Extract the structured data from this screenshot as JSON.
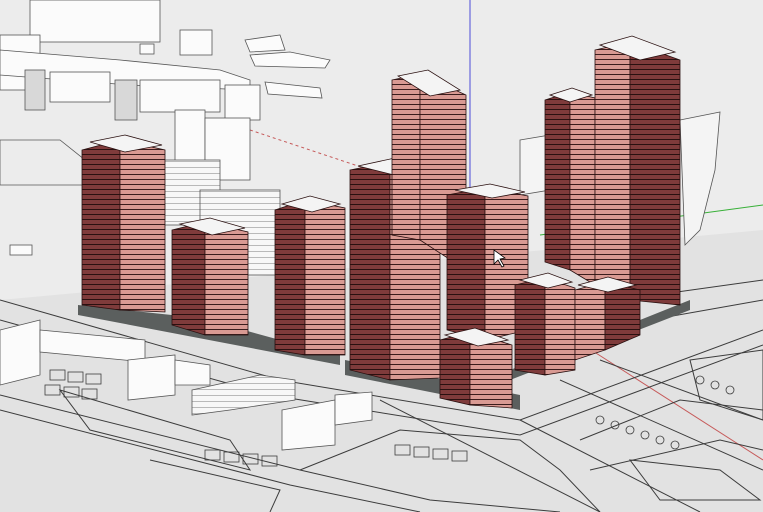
{
  "scene": {
    "colors": {
      "ground": "#e6e6e6",
      "ground_dark": "#d7d7d7",
      "block_white": "#fbfbfb",
      "block_shadow": "#d2d2d2",
      "tower_light": "#d99a93",
      "tower_dark": "#7f3b3b",
      "tower_roof": "#f4f4f4",
      "podium": "#5b5f5e",
      "road_line": "#3c3c3c",
      "axis_blue": "#4b4bd8",
      "axis_green": "#38b038",
      "axis_red": "#c65a5a"
    }
  }
}
